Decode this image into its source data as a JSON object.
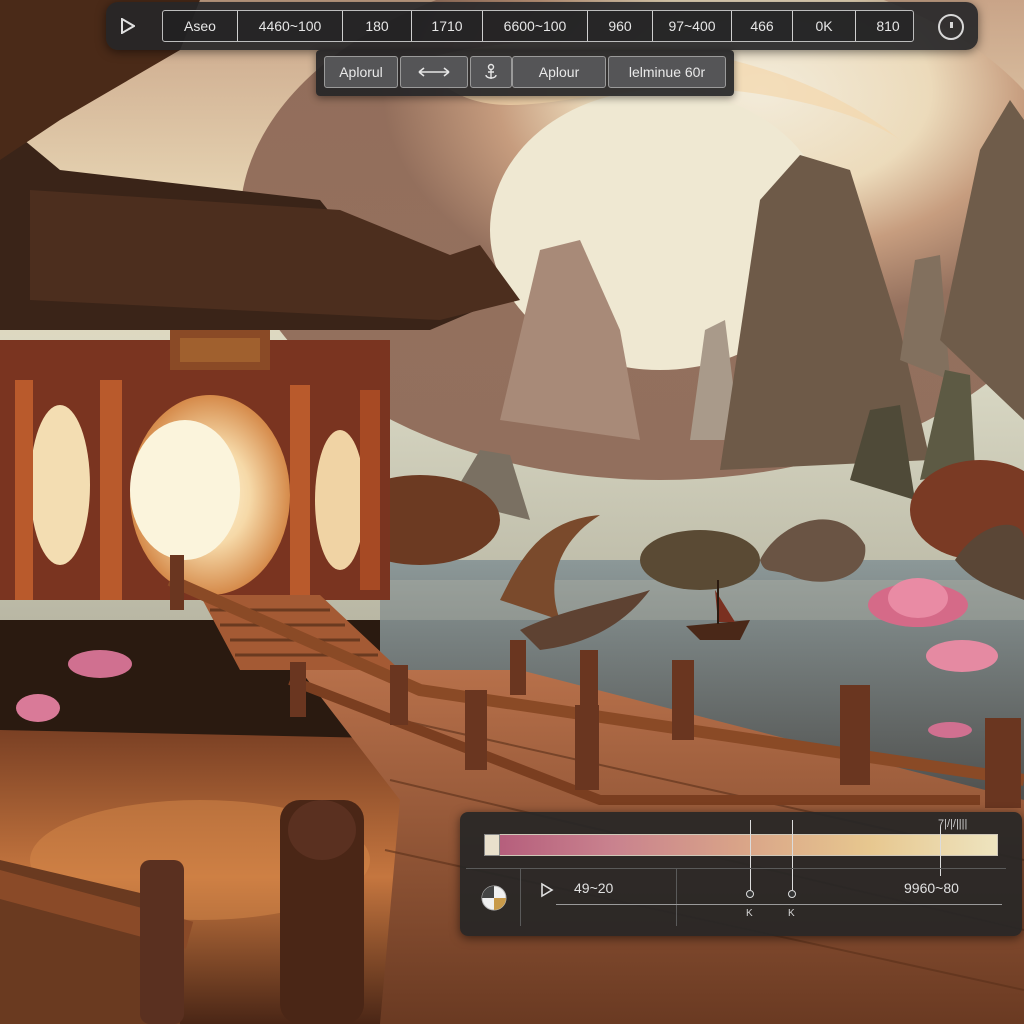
{
  "toolbar": {
    "play_icon": "play-icon",
    "segments": [
      "Aseo",
      "4460~100",
      "180",
      "1710",
      "6600~100",
      "960",
      "97~400",
      "466",
      "0K",
      "810"
    ],
    "clock_icon": "clock-icon"
  },
  "subbar": {
    "apply_left": "Aplorul",
    "resize_icon": "double-arrow-icon",
    "anchor_icon": "anchor-icon",
    "apply_right": "Aplour",
    "label": "lelminue 60r"
  },
  "timeline": {
    "gradient_colors": [
      "#b35a7a",
      "#c9828e",
      "#d9a488",
      "#e7c78f",
      "#eee4bf"
    ],
    "top_right_label": "7|/|/||||",
    "start_label": "49~20",
    "end_label": "9960~80",
    "marker_a": "K",
    "marker_b": "K",
    "pie_icon": "pie-chart-icon",
    "play_icon": "play-icon"
  }
}
